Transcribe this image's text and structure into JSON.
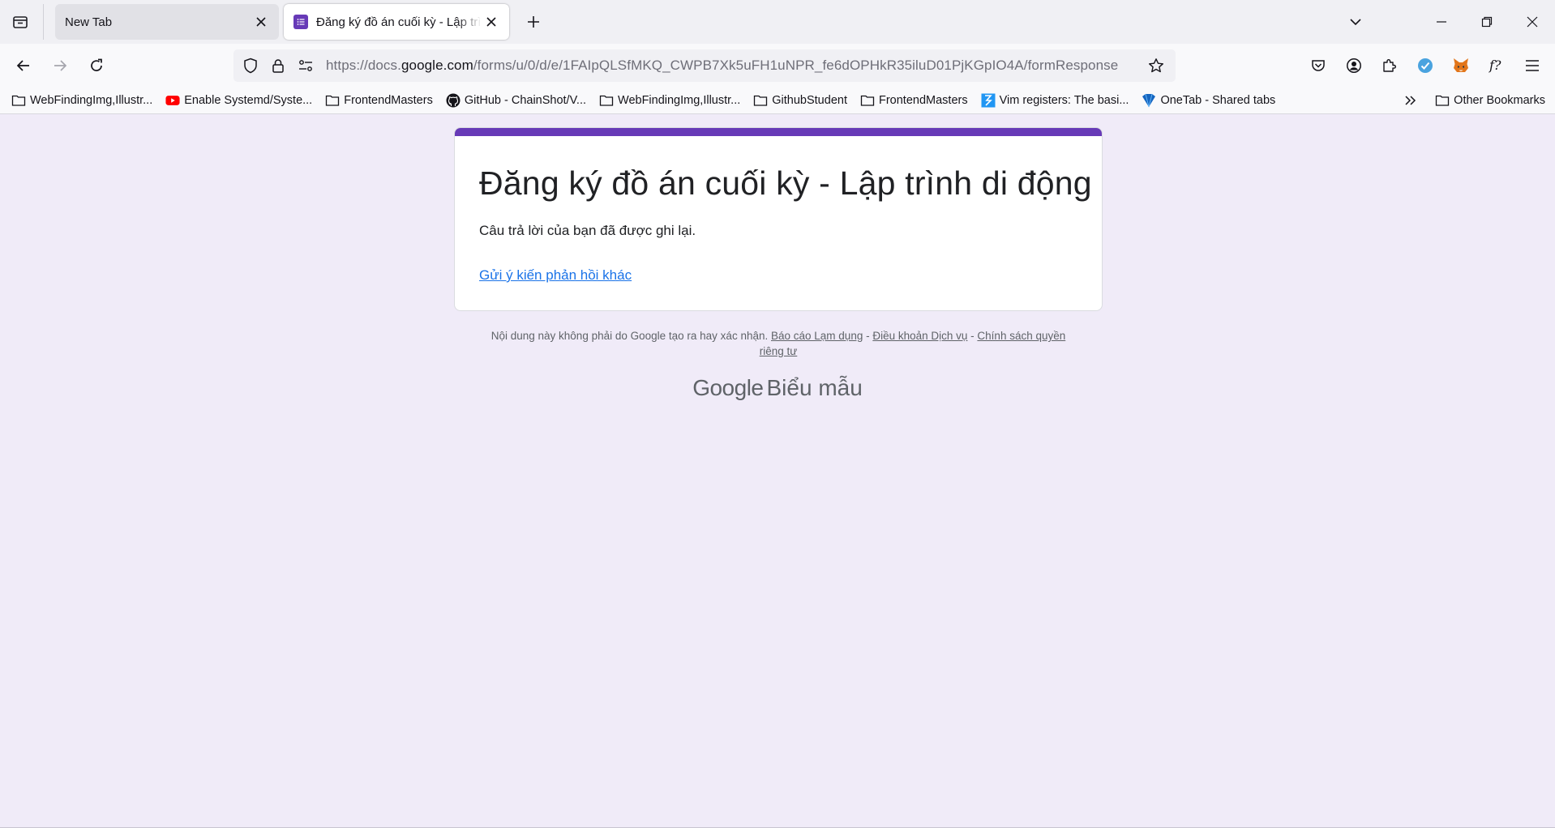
{
  "tabs": [
    {
      "title": "New Tab",
      "active": false
    },
    {
      "title": "Đăng ký đồ án cuối kỳ - Lập trình di động",
      "active": true
    }
  ],
  "nav": {
    "url_prefix": "https://docs.",
    "url_host": "google.com",
    "url_path": "/forms/u/0/d/e/1FAIpQLSfMKQ_CWPB7Xk5uFH1uNPR_fe6dOPHkR35iluD01PjKGpIO4A/formResponse"
  },
  "bookmarks": [
    {
      "label": "WebFindingImg,Illustr...",
      "icon": "folder-icon"
    },
    {
      "label": "Enable Systemd/Syste...",
      "icon": "youtube-icon"
    },
    {
      "label": "FrontendMasters",
      "icon": "folder-icon"
    },
    {
      "label": "GitHub - ChainShot/V...",
      "icon": "github-icon"
    },
    {
      "label": "WebFindingImg,Illustr...",
      "icon": "folder-icon"
    },
    {
      "label": "GithubStudent",
      "icon": "folder-icon"
    },
    {
      "label": "FrontendMasters",
      "icon": "folder-icon"
    },
    {
      "label": "Vim registers: The basi...",
      "icon": "site-icon"
    },
    {
      "label": "OneTab - Shared tabs",
      "icon": "onetab-icon"
    }
  ],
  "other_bookmarks": "Other Bookmarks",
  "form": {
    "title": "Đăng ký đồ án cuối kỳ - Lập trình di động",
    "confirmation": "Câu trả lời của bạn đã được ghi lại.",
    "submit_another": "Gửi ý kiến phản hồi khác"
  },
  "footer": {
    "disclaimer": "Nội dung này không phải do Google tạo ra hay xác nhận.",
    "report_abuse": "Báo cáo Lạm dụng",
    "terms": "Điều khoản Dịch vụ",
    "privacy": "Chính sách quyền riêng tư",
    "sep": " - "
  },
  "brand": {
    "google": "Google",
    "forms": "Biểu mẫu"
  },
  "colors": {
    "accent": "#673ab7",
    "link": "#1a73e8",
    "page_bg": "#f0ebf8"
  }
}
